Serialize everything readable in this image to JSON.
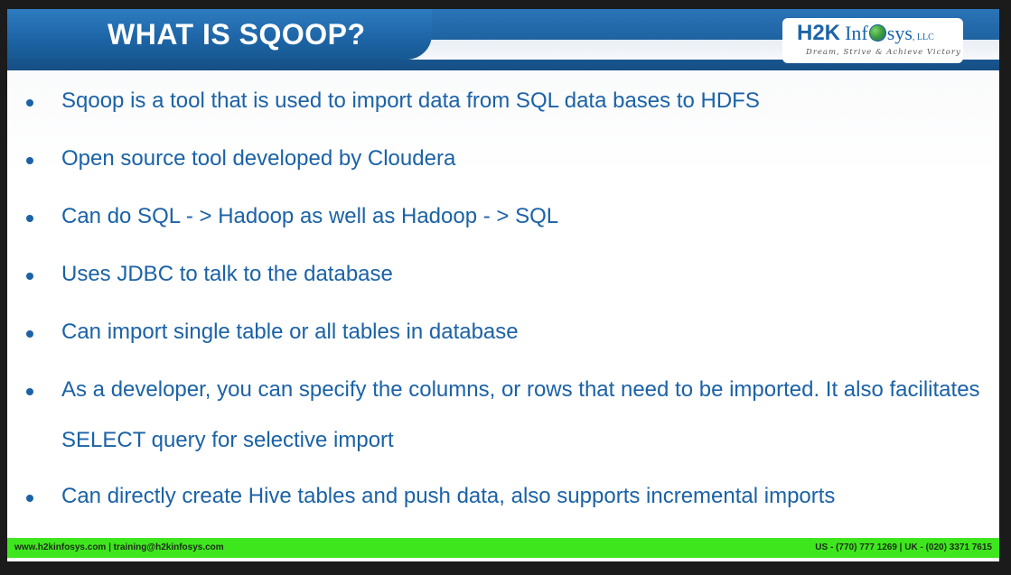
{
  "slide": {
    "title": "WHAT IS SQOOP?",
    "logo": {
      "h2k": "H2K",
      "inf": "Inf",
      "sys": "sys",
      "llc": ", LLC",
      "tagline": "Dream, Strive & Achieve Victory"
    },
    "bullets": [
      "Sqoop is a tool that is used to import data from SQL data bases to HDFS",
      "Open source tool developed by Cloudera",
      "Can do SQL - > Hadoop as well as Hadoop - > SQL",
      "Uses JDBC to talk to the database",
      "Can import single table or all tables in database",
      "As a developer, you can specify the columns, or rows that need to be imported. It also facilitates SELECT query for selective import",
      "Can directly create Hive tables and push data, also supports incremental imports"
    ],
    "footer": {
      "left": "www.h2kinfosys.com  |  training@h2kinfosys.com",
      "right": "US - (770) 777 1269  |  UK - (020) 3371 7615"
    }
  },
  "colors": {
    "header_blue": "#1e66a8",
    "text_blue": "#1b62a6",
    "footer_green": "#3ee61e"
  },
  "icons": {
    "logo_globe": "globe-icon"
  }
}
